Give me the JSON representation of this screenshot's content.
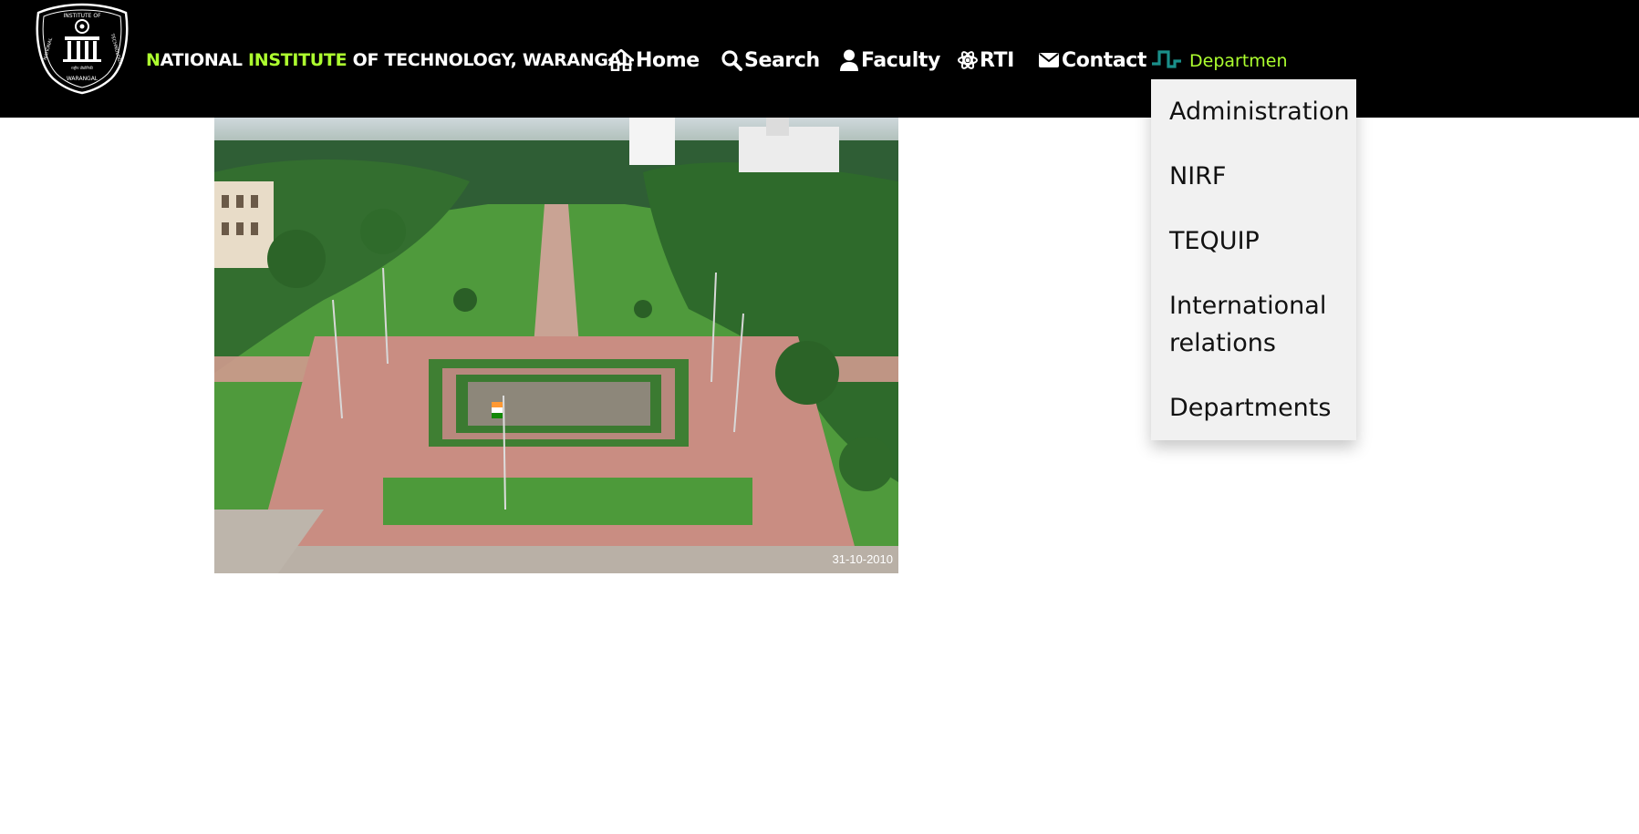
{
  "brand": {
    "part1": "N",
    "part2": "ATIONAL ",
    "part3": "INSTITUTE",
    "part4": " OF TECHNOLOGY, WARANGAL",
    "logo_icon": "nit-warangal-emblem",
    "logo_text_top": "INSTITUTE OF",
    "logo_text_left": "NATIONAL",
    "logo_text_right": "TECHNOLOGY",
    "logo_text_bottom": "WARANGAL"
  },
  "nav": {
    "home": {
      "label": "Home",
      "icon": "home-icon"
    },
    "search": {
      "label": "Search",
      "icon": "search-icon"
    },
    "faculty": {
      "label": "Faculty",
      "icon": "user-icon"
    },
    "rti": {
      "label": "RTI",
      "icon": "atom-icon"
    },
    "contact": {
      "label": "Contact",
      "icon": "envelope-icon"
    },
    "departments": {
      "label": "Departmen",
      "icon": "pulse-wave-icon"
    }
  },
  "dropdown": {
    "items": [
      "Administration",
      "NIRF",
      "TEQUIP",
      "International relations",
      "Departments"
    ]
  },
  "photo": {
    "date_stamp": "31-10-2010"
  },
  "colors": {
    "navbar_bg": "#000000",
    "brand_accent": "#adff2f",
    "dropdown_bg": "#f1f1f1",
    "wave_icon": "#1a8f8a"
  }
}
